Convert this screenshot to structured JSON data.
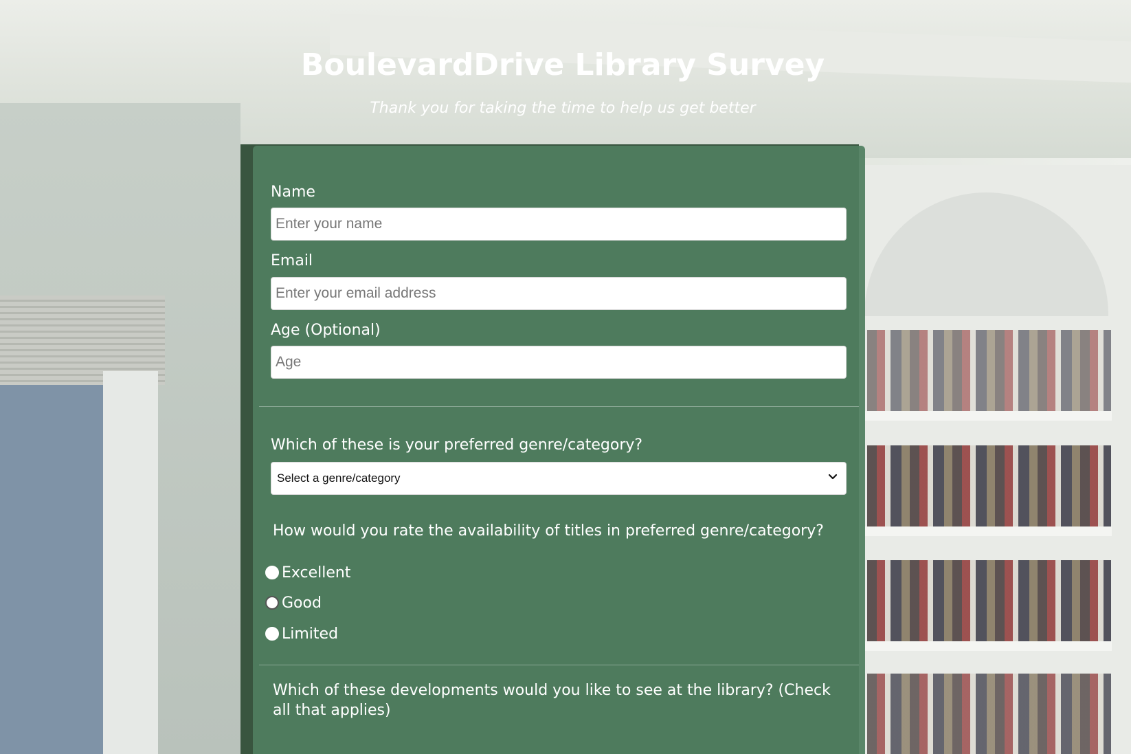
{
  "header": {
    "title": "BoulevardDrive Library Survey",
    "subtitle": "Thank you for taking the time to help us get better"
  },
  "form": {
    "name": {
      "label": "Name",
      "placeholder": "Enter your name",
      "value": ""
    },
    "email": {
      "label": "Email",
      "placeholder": "Enter your email address",
      "value": ""
    },
    "age": {
      "label": "Age (Optional)",
      "placeholder": "Age",
      "value": ""
    },
    "genre": {
      "question": "Which of these is your preferred genre/category?",
      "selected": "Select a genre/category"
    },
    "rating": {
      "question": "How would you rate the availability of titles in preferred genre/category?",
      "options": [
        "Excellent",
        "Good",
        "Limited"
      ],
      "focused_option": "Good"
    },
    "developments": {
      "question": "Which of these developments would you like to see at the library? (Check all that applies)"
    }
  },
  "colors": {
    "panel": "#507e60",
    "text": "#ffffff",
    "input_bg": "#ffffff"
  },
  "icons": {
    "select_arrow": "chevron-down-icon"
  }
}
